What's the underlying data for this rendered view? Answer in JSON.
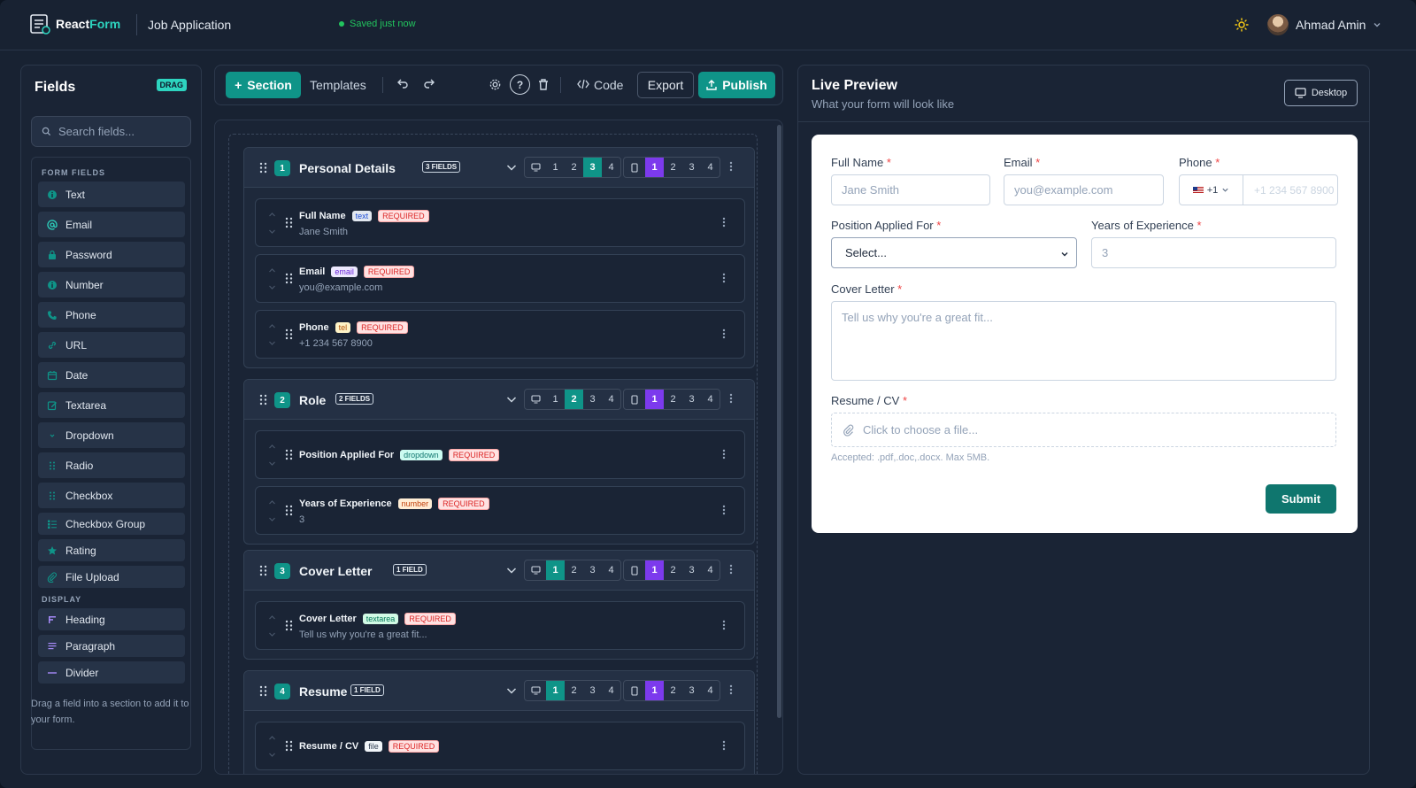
{
  "app": {
    "name_a": "React",
    "name_b": "Form",
    "doc_title": "Job Application",
    "saved_status": "Saved just now",
    "user_name": "Ahmad Amin",
    "accent": "#0f9488",
    "accent_secondary": "#7c3aed"
  },
  "sidebar": {
    "title": "Fields",
    "badge": "DRAG",
    "search_placeholder": "Search fields...",
    "section_form": "FORM FIELDS",
    "form_fields": [
      {
        "label": "Text",
        "icon": "info-icon"
      },
      {
        "label": "Email",
        "icon": "at-icon"
      },
      {
        "label": "Password",
        "icon": "lock-icon"
      },
      {
        "label": "Number",
        "icon": "info-icon"
      },
      {
        "label": "Phone",
        "icon": "phone-icon"
      },
      {
        "label": "URL",
        "icon": "link-icon"
      },
      {
        "label": "Date",
        "icon": "calendar-icon"
      },
      {
        "label": "Textarea",
        "icon": "edit-icon"
      },
      {
        "label": "Dropdown",
        "icon": "chevron-icon"
      },
      {
        "label": "Radio",
        "icon": "grip-icon"
      },
      {
        "label": "Checkbox",
        "icon": "grip-icon"
      },
      {
        "label": "Checkbox Group",
        "icon": "list-icon"
      },
      {
        "label": "Rating",
        "icon": "star-icon"
      },
      {
        "label": "File Upload",
        "icon": "paperclip-icon"
      }
    ],
    "section_display": "DISPLAY",
    "display_fields": [
      {
        "label": "Heading",
        "icon": "heading-icon"
      },
      {
        "label": "Paragraph",
        "icon": "paragraph-icon"
      },
      {
        "label": "Divider",
        "icon": "divider-icon"
      }
    ],
    "hint": "Drag a field into a section to add it to your form."
  },
  "toolbar": {
    "section_label": "Section",
    "templates_label": "Templates",
    "help_label": "?",
    "code_label": "Code",
    "export_label": "Export",
    "publish_label": "Publish"
  },
  "sections": [
    {
      "num": "1",
      "title": "Personal Details",
      "count": "3 FIELDS",
      "desktop_cols": 3,
      "mobile_cols": 1,
      "fields": [
        {
          "label": "Full Name",
          "type": "text",
          "required": "REQUIRED",
          "value": "Jane Smith"
        },
        {
          "label": "Email",
          "type": "email",
          "required": "REQUIRED",
          "value": "you@example.com"
        },
        {
          "label": "Phone",
          "type": "tel",
          "required": "REQUIRED",
          "value": "+1 234 567 8900"
        }
      ]
    },
    {
      "num": "2",
      "title": "Role",
      "count": "2 FIELDS",
      "desktop_cols": 2,
      "mobile_cols": 1,
      "fields": [
        {
          "label": "Position Applied For",
          "type": "dropdown",
          "required": "REQUIRED",
          "value": ""
        },
        {
          "label": "Years of Experience",
          "type": "number",
          "required": "REQUIRED",
          "value": "3"
        }
      ]
    },
    {
      "num": "3",
      "title": "Cover Letter",
      "count": "1 FIELD",
      "desktop_cols": 1,
      "mobile_cols": 1,
      "fields": [
        {
          "label": "Cover Letter",
          "type": "textarea",
          "required": "REQUIRED",
          "value": "Tell us why you're a great fit..."
        }
      ]
    },
    {
      "num": "4",
      "title": "Resume",
      "count": "1 FIELD",
      "desktop_cols": 1,
      "mobile_cols": 1,
      "fields": [
        {
          "label": "Resume / CV",
          "type": "file",
          "required": "REQUIRED",
          "value": ""
        }
      ]
    }
  ],
  "column_options": [
    "1",
    "2",
    "3",
    "4"
  ],
  "preview": {
    "title": "Live Preview",
    "subtitle": "What your form will look like",
    "device_label": "Desktop",
    "required_mark": "*",
    "full_name": {
      "label": "Full Name",
      "placeholder": "Jane Smith"
    },
    "email": {
      "label": "Email",
      "placeholder": "you@example.com"
    },
    "phone": {
      "label": "Phone",
      "code": "+1",
      "placeholder": "+1 234 567 8900"
    },
    "position": {
      "label": "Position Applied For",
      "selected": "Select..."
    },
    "experience": {
      "label": "Years of Experience",
      "placeholder": "3"
    },
    "cover": {
      "label": "Cover Letter",
      "placeholder": "Tell us why you're a great fit..."
    },
    "resume": {
      "label": "Resume / CV",
      "placeholder": "Click to choose a file...",
      "accepted": "Accepted: .pdf,.doc,.docx. Max 5MB."
    },
    "submit_label": "Submit"
  }
}
